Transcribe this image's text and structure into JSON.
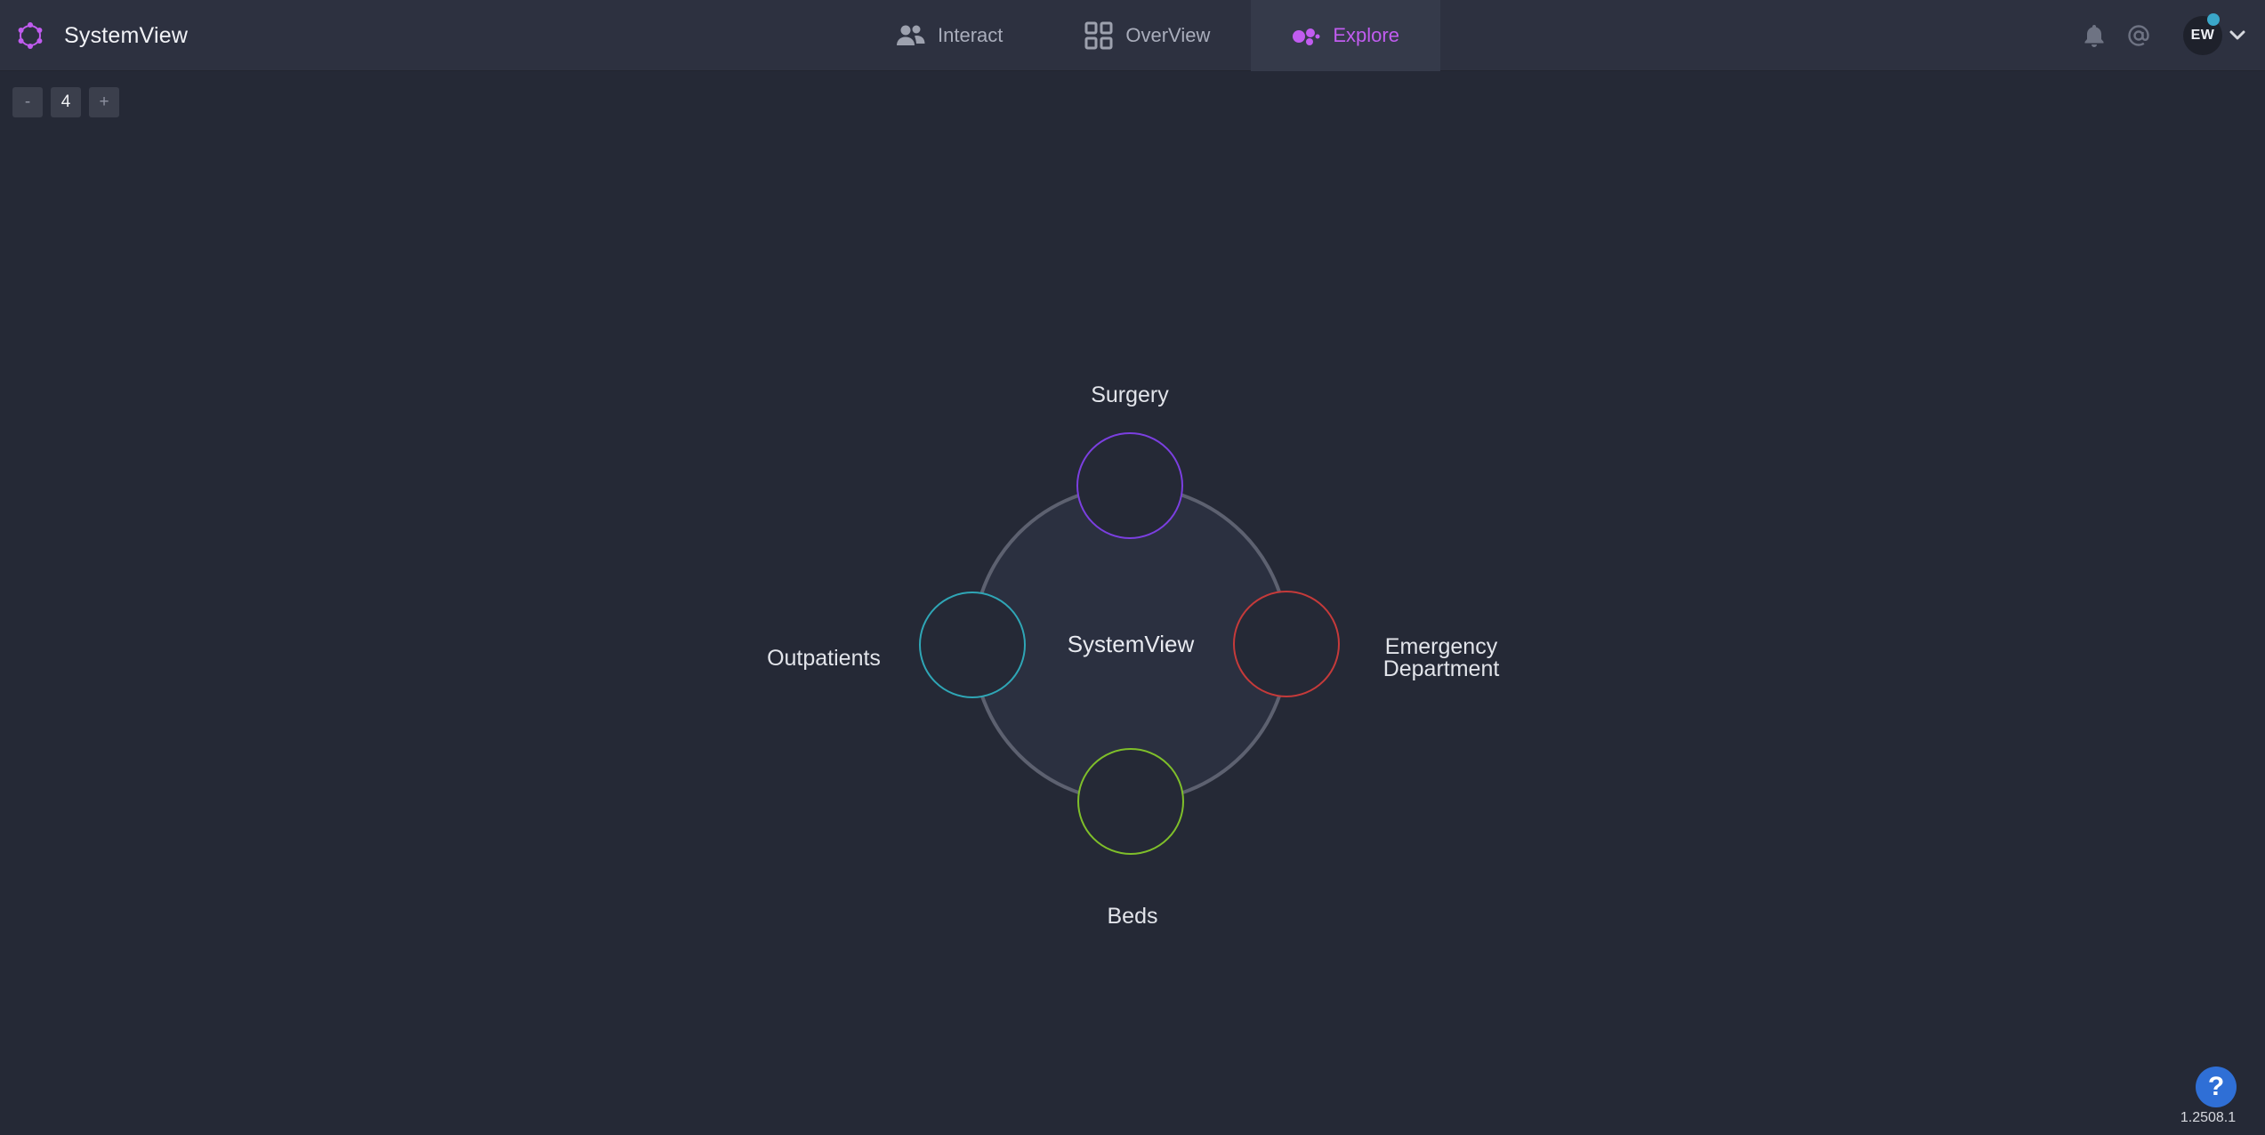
{
  "app": {
    "name": "SystemView"
  },
  "tabs": [
    {
      "label": "Interact",
      "icon": "users-icon",
      "active": false
    },
    {
      "label": "OverView",
      "icon": "grid-icon",
      "active": false
    },
    {
      "label": "Explore",
      "icon": "explore-icon",
      "active": true
    }
  ],
  "header_icons": [
    "bell-icon",
    "at-icon",
    "chevron-down-icon"
  ],
  "user": {
    "initials": "EW",
    "status_color": "#3aa6c8"
  },
  "level_stepper": {
    "minus_label": "-",
    "value": "4",
    "plus_label": "+"
  },
  "diagram": {
    "center_label": "SystemView",
    "nodes": [
      {
        "label": "Surgery",
        "color": "#7b3fe0"
      },
      {
        "label": "Emergency Department",
        "label_lines": [
          "Emergency",
          "Department"
        ],
        "color": "#c53a3a"
      },
      {
        "label": "Beds",
        "color": "#7fbf2a"
      },
      {
        "label": "Outpatients",
        "color": "#2fa6b6"
      }
    ]
  },
  "colors": {
    "background": "#252936",
    "topbar": "#2d3140",
    "accent": "#c15cf0",
    "help": "#2f6fd6"
  },
  "help": {
    "label": "?"
  },
  "version": "1.2508.1"
}
